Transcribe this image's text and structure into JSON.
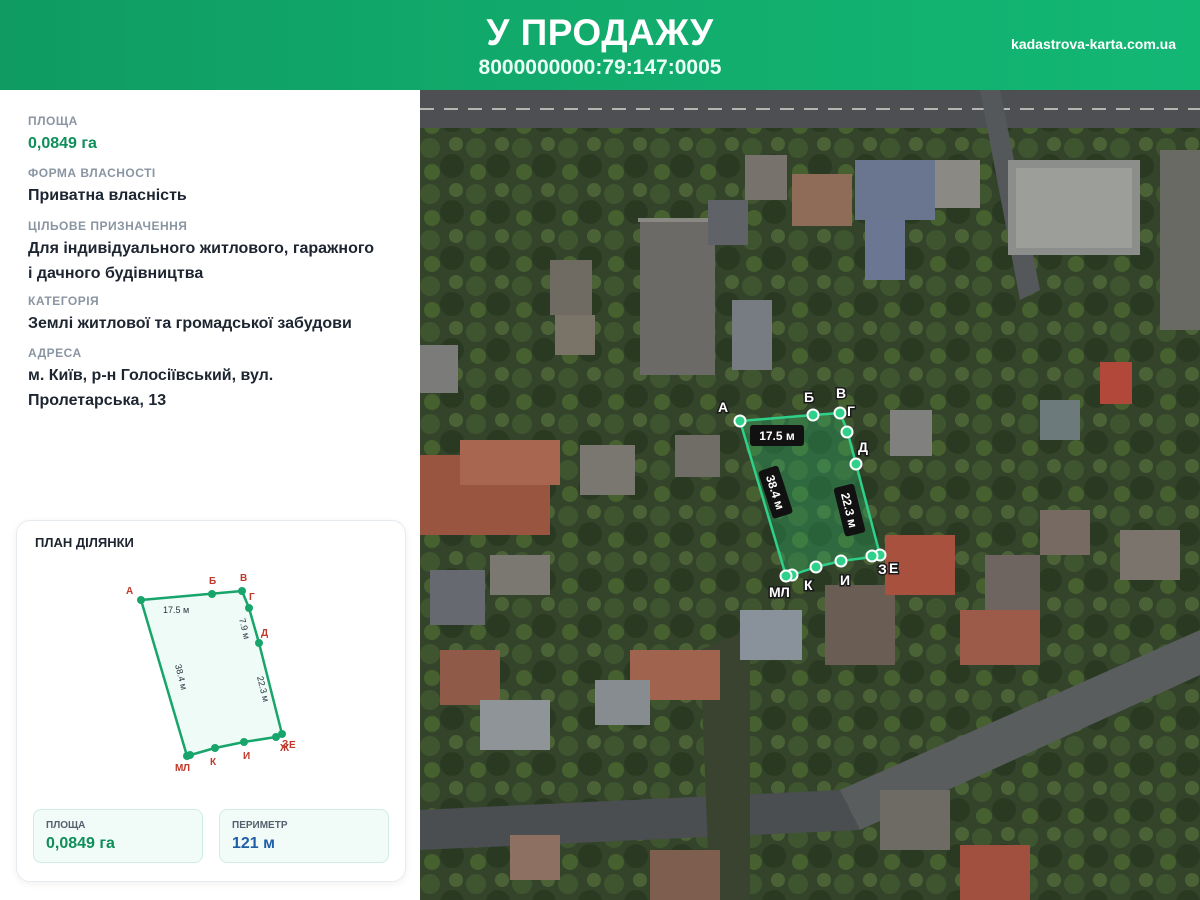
{
  "header": {
    "title": "У ПРОДАЖУ",
    "cadastral": "8000000000:79:147:0005",
    "site": "kadastrova-karta.com.ua"
  },
  "info": {
    "area_label": "ПЛОЩА",
    "area_value": "0,0849 га",
    "ownership_label": "ФОРМА ВЛАСНОСТІ",
    "ownership_value": "Приватна власність",
    "purpose_label": "ЦІЛЬОВЕ ПРИЗНАЧЕННЯ",
    "purpose_line1": "Для індивідуального житлового, гаражного",
    "purpose_line2": "і дачного будівництва",
    "category_label": "КАТЕГОРІЯ",
    "category_value": "Землі житлової та громадської забудови",
    "address_label": "АДРЕСА",
    "address_line1": "м. Київ, р-н Голосіївський, вул.",
    "address_line2": "Пролетарська, 13"
  },
  "plan": {
    "title": "ПЛАН ДІЛЯНКИ",
    "vertices": {
      "a": "А",
      "b": "Б",
      "v": "В",
      "g": "Г",
      "d": "Д",
      "e": "Е",
      "zh": "Ж",
      "z": "З",
      "i": "И",
      "k": "К",
      "l": "Л",
      "m": "М"
    },
    "edges": {
      "top": "17.5 м",
      "small": "7.9 м",
      "right": "22.3 м",
      "left": "38.4 м"
    },
    "stats": {
      "area_label": "ПЛОЩА",
      "area_value": "0,0849 га",
      "perimeter_label": "ПЕРИМЕТР",
      "perimeter_value": "121 м"
    }
  },
  "map": {
    "edges": {
      "top": "17.5 м",
      "left": "38.4 м",
      "right": "22.3 м"
    }
  },
  "colors": {
    "accent": "#12a86a",
    "vertex_label": "#c0392b",
    "perimeter_value": "#1e5fa8"
  }
}
